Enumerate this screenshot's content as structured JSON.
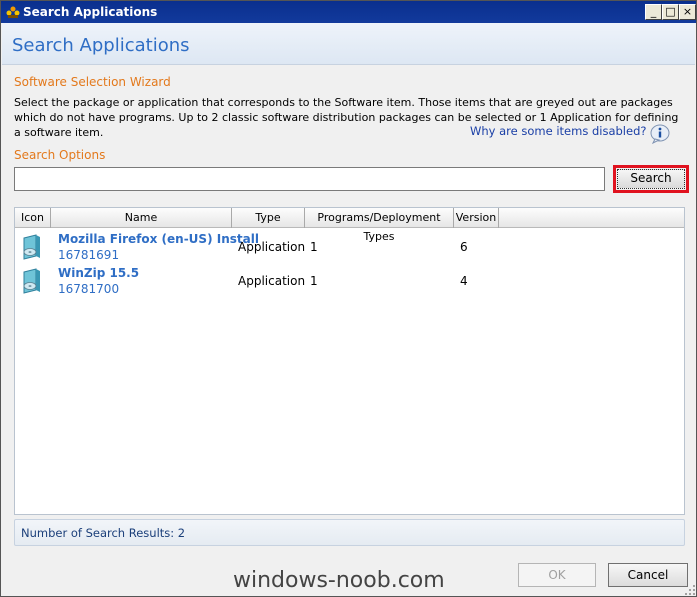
{
  "window": {
    "title": "Search Applications",
    "controls": {
      "minimize": "_",
      "maximize": "□",
      "close": "×"
    }
  },
  "header": {
    "title": "Search Applications"
  },
  "wizard": {
    "label": "Software Selection Wizard",
    "description": "Select the package or application that corresponds to the Software item.  Those items that are greyed out are packages which do not have programs.  Up to 2 classic software distribution packages can be selected or 1 Application for defining a software item.",
    "why_link": "Why are some items disabled?"
  },
  "search": {
    "label": "Search Options",
    "value": "",
    "button_label": "Search",
    "highlight_color": "#e0121f"
  },
  "table": {
    "columns": [
      "Icon",
      "Name",
      "Type",
      "Programs/Deployment Types",
      "Version"
    ],
    "rows": [
      {
        "icon": "application-icon",
        "name": "Mozilla Firefox (en-US) Install",
        "id": "16781691",
        "type": "Application",
        "programs": "1",
        "version": "6"
      },
      {
        "icon": "application-icon",
        "name": "WinZip 15.5",
        "id": "16781700",
        "type": "Application",
        "programs": "1",
        "version": "4"
      }
    ]
  },
  "status": {
    "text": "Number of Search Results: 2"
  },
  "footer": {
    "watermark": "windows-noob.com",
    "ok_label": "OK",
    "cancel_label": "Cancel"
  },
  "colors": {
    "accent_blue": "#2f6ec5",
    "accent_orange": "#e3791c",
    "title_bar": "#0a2f8e"
  }
}
